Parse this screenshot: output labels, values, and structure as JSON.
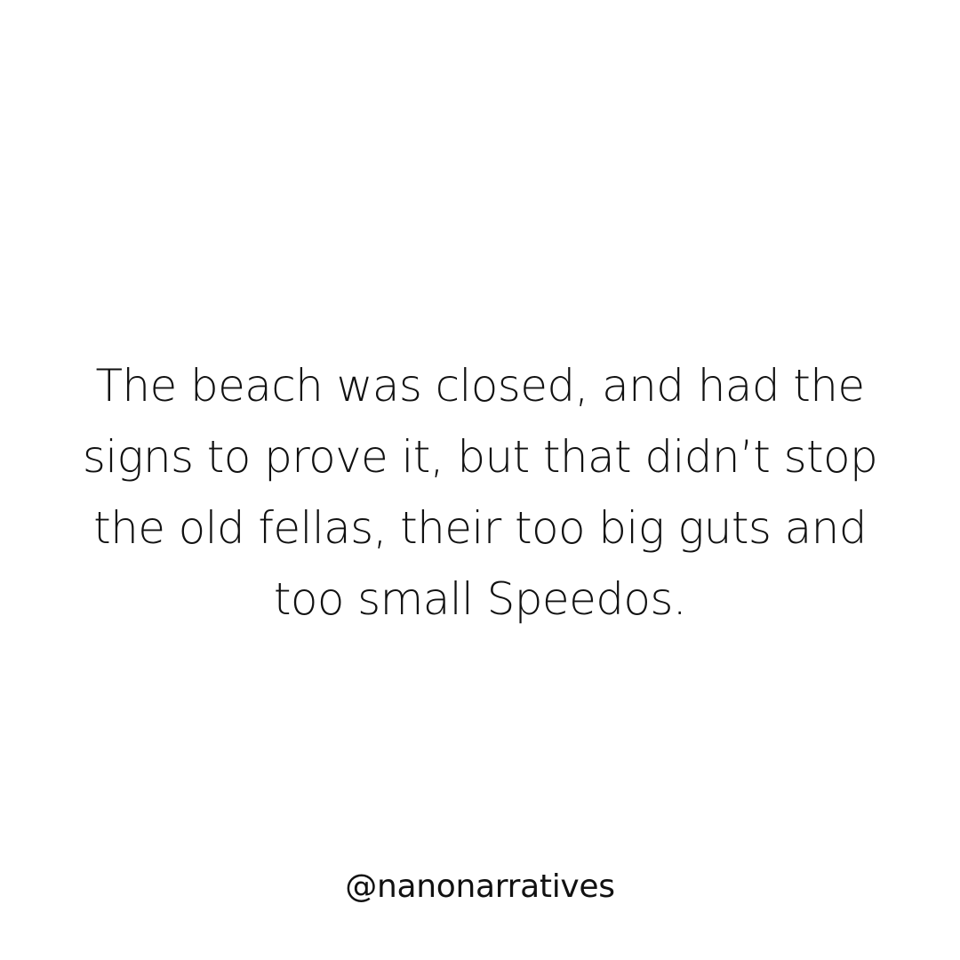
{
  "quote": {
    "lines": [
      "The beach was closed, and had the",
      "signs to prove it, but that didn’t stop",
      "the old fellas, their too big guts and",
      "too small Speedos."
    ]
  },
  "footer": {
    "handle": "@nanonarratives"
  },
  "colors": {
    "background": "#ffffff",
    "text": "#111111"
  }
}
